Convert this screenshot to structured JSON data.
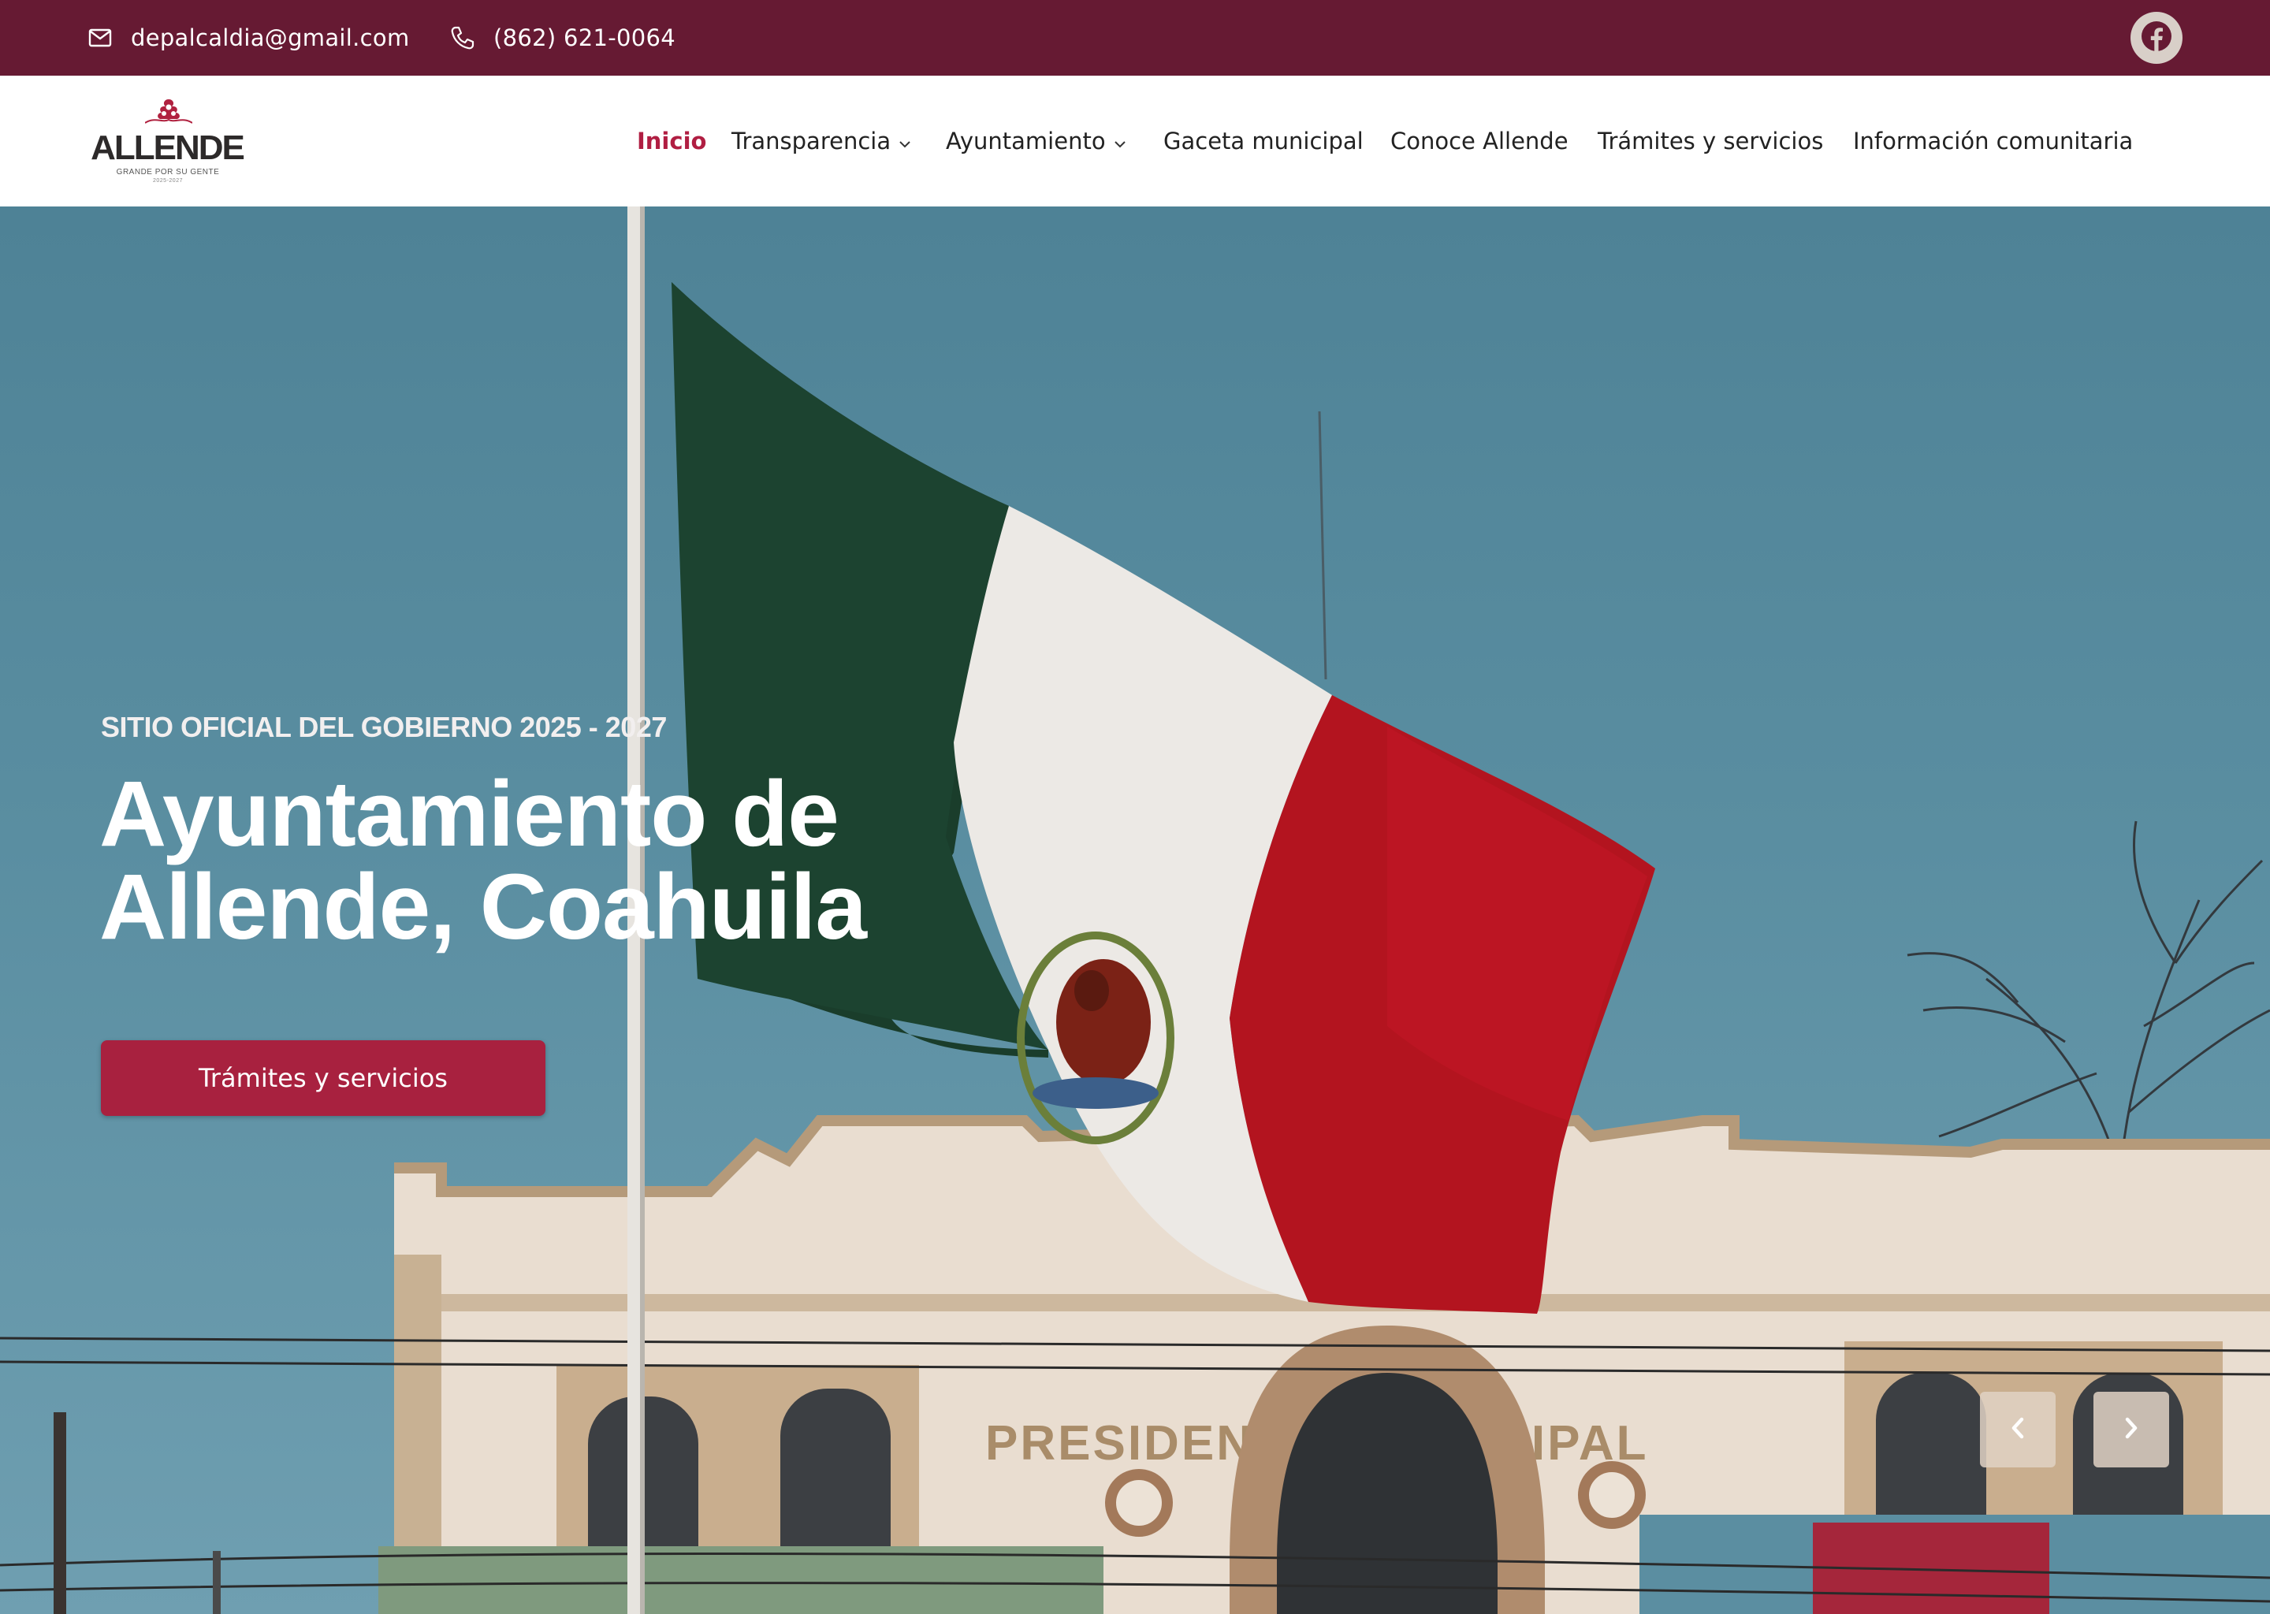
{
  "topbar": {
    "email": "depalcaldia@gmail.com",
    "phone": "(862) 621-0064",
    "icons": {
      "email": "mail-icon",
      "phone": "phone-icon",
      "social": "facebook-icon"
    },
    "colors": {
      "background": "#661a33"
    }
  },
  "header": {
    "logo": {
      "word": "ALLENDE",
      "tagline": "GRANDE POR SU GENTE",
      "years": "2025-2027"
    },
    "nav": [
      {
        "label": "Inicio",
        "active": true
      },
      {
        "label": "Transparencia",
        "dropdown": true
      },
      {
        "label": "Ayuntamiento",
        "dropdown": true
      },
      {
        "label": "Gaceta municipal"
      },
      {
        "label": "Conoce Allende"
      },
      {
        "label": "Trámites y servicios"
      },
      {
        "label": "Información comunitaria"
      }
    ],
    "chevron": "⌄",
    "colors": {
      "active": "#b01e42"
    }
  },
  "hero": {
    "kicker": "SITIO OFICIAL DEL GOBIERNO 2025 - 2027",
    "title_line1": "Ayuntamiento de",
    "title_line2": "Allende, Coahuila",
    "cta_label": "Trámites y servicios",
    "building_sign": "PRESIDENCIA MUNICIPAL",
    "carousel": {
      "prev_icon": "chevron-left-icon",
      "next_icon": "chevron-right-icon"
    },
    "colors": {
      "cta": "#a8213f"
    }
  }
}
